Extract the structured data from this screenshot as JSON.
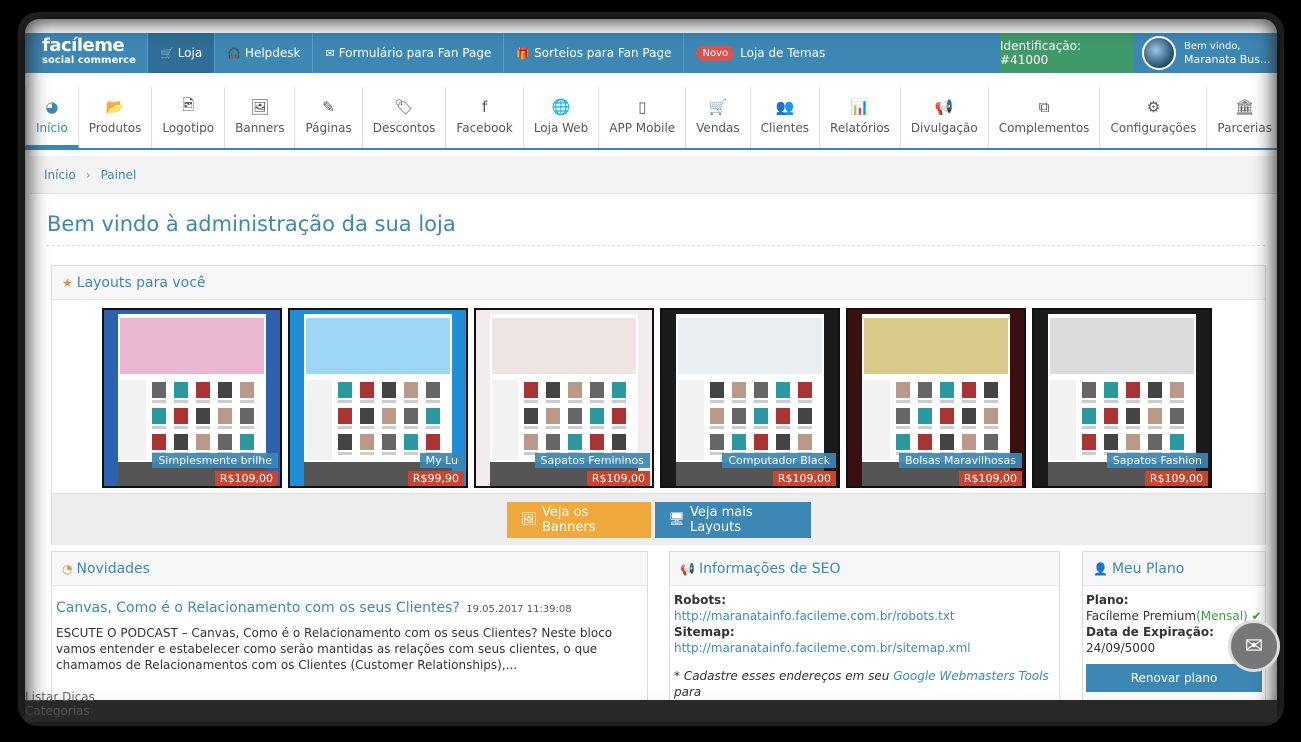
{
  "brand": {
    "name": "facíleme",
    "tagline": "social commerce"
  },
  "topnav": [
    {
      "icon": "cart-icon",
      "glyph": "🛒",
      "label": "Loja",
      "active": true
    },
    {
      "icon": "headset-icon",
      "glyph": "🎧",
      "label": "Helpdesk"
    },
    {
      "icon": "envelope-icon",
      "glyph": "✉",
      "label": "Formulário para Fan Page"
    },
    {
      "icon": "gift-icon",
      "glyph": "🎁",
      "label": "Sorteios para Fan Page"
    },
    {
      "icon": "",
      "badge": "Novo",
      "label": "Loja de Temas"
    }
  ],
  "identification": "Identificação: #41000",
  "user": {
    "greeting": "Bem vindo,",
    "name": "Maranata Bus..."
  },
  "mainnav": [
    {
      "icon": "dashboard-icon",
      "glyph": "◕",
      "label": "Início",
      "active": true
    },
    {
      "icon": "folder-icon",
      "glyph": "📂",
      "label": "Produtos"
    },
    {
      "icon": "image-file-icon",
      "glyph": "🖻",
      "label": "Logotipo"
    },
    {
      "icon": "picture-icon",
      "glyph": "🖼",
      "label": "Banners"
    },
    {
      "icon": "edit-icon",
      "glyph": "✎",
      "label": "Páginas"
    },
    {
      "icon": "tags-icon",
      "glyph": "🏷",
      "label": "Descontos"
    },
    {
      "icon": "facebook-icon",
      "glyph": "f",
      "label": "Facebook"
    },
    {
      "icon": "globe-icon",
      "glyph": "🌐",
      "label": "Loja Web"
    },
    {
      "icon": "mobile-icon",
      "glyph": "▯",
      "label": "APP Mobile"
    },
    {
      "icon": "cart-icon",
      "glyph": "🛒",
      "label": "Vendas"
    },
    {
      "icon": "users-icon",
      "glyph": "👥",
      "label": "Clientes"
    },
    {
      "icon": "bar-chart-icon",
      "glyph": "📊",
      "label": "Relatórios"
    },
    {
      "icon": "bullhorn-icon",
      "glyph": "📢",
      "label": "Divulgação"
    },
    {
      "icon": "cubes-icon",
      "glyph": "⧉",
      "label": "Complementos"
    },
    {
      "icon": "gears-icon",
      "glyph": "⚙",
      "label": "Configurações"
    },
    {
      "icon": "bank-icon",
      "glyph": "🏛",
      "label": "Parcerias"
    }
  ],
  "breadcrumb": {
    "home": "Início",
    "current": "Painel"
  },
  "page_title": "Bem vindo à administração da sua loja",
  "layouts": {
    "heading": "Layouts para você",
    "items": [
      {
        "name": "Simplesmente brilhe",
        "price": "R$109,00",
        "bg": "#2c62b0",
        "hero": "#e9b7cf"
      },
      {
        "name": "My Lu",
        "price": "R$99,90",
        "bg": "#1e8fd6",
        "hero": "#9ed7f5"
      },
      {
        "name": "Sapatos Femininos",
        "price": "R$109,00",
        "bg": "#f3ecec",
        "hero": "#efe4e4"
      },
      {
        "name": "Computador Black",
        "price": "R$109,00",
        "bg": "#1b1b1b",
        "hero": "#e9eef2"
      },
      {
        "name": "Bolsas Maravilhosas",
        "price": "R$109,00",
        "bg": "#3a0f0f",
        "hero": "#d9c98a"
      },
      {
        "name": "Sapatos Fashion",
        "price": "R$109,00",
        "bg": "#1b1b1b",
        "hero": "#dcdcdc"
      }
    ],
    "btn_banners": "Veja os Banners",
    "btn_more": "Veja mais Layouts"
  },
  "news": {
    "heading": "Novidades",
    "title": "Canvas, Como é o Relacionamento com os seus Clientes?",
    "date": "19.05.2017 11:39:08",
    "body": "ESCUTE O PODCAST – Canvas, Como é o Relacionamento com os seus Clientes? Neste bloco vamos entender e estabelecer como serão mantidas as relações com seus clientes, o que chamamos de Relacionamentos com os Clientes (Customer Relationships),..."
  },
  "seo": {
    "heading": "Informações de SEO",
    "robots_label": "Robots:",
    "robots_url": "http://maranatainfo.facileme.com.br/robots.txt",
    "sitemap_label": "Sitemap:",
    "sitemap_url": "http://maranatainfo.facileme.com.br/sitemap.xml",
    "note_prefix": "* Cadastre esses endereços em seu",
    "note_link": "Google Webmasters Tools",
    "note_suffix": "para"
  },
  "plan": {
    "heading": "Meu Plano",
    "plan_label": "Plano:",
    "plan_name": "Facíleme Premium",
    "plan_period": "(Mensal)",
    "expiry_label": "Data de Expiração:",
    "expiry_date": "24/09/5000",
    "renew": "Renovar plano"
  },
  "leak": {
    "l1": "Listar Dicas",
    "l2": "Categorias"
  }
}
